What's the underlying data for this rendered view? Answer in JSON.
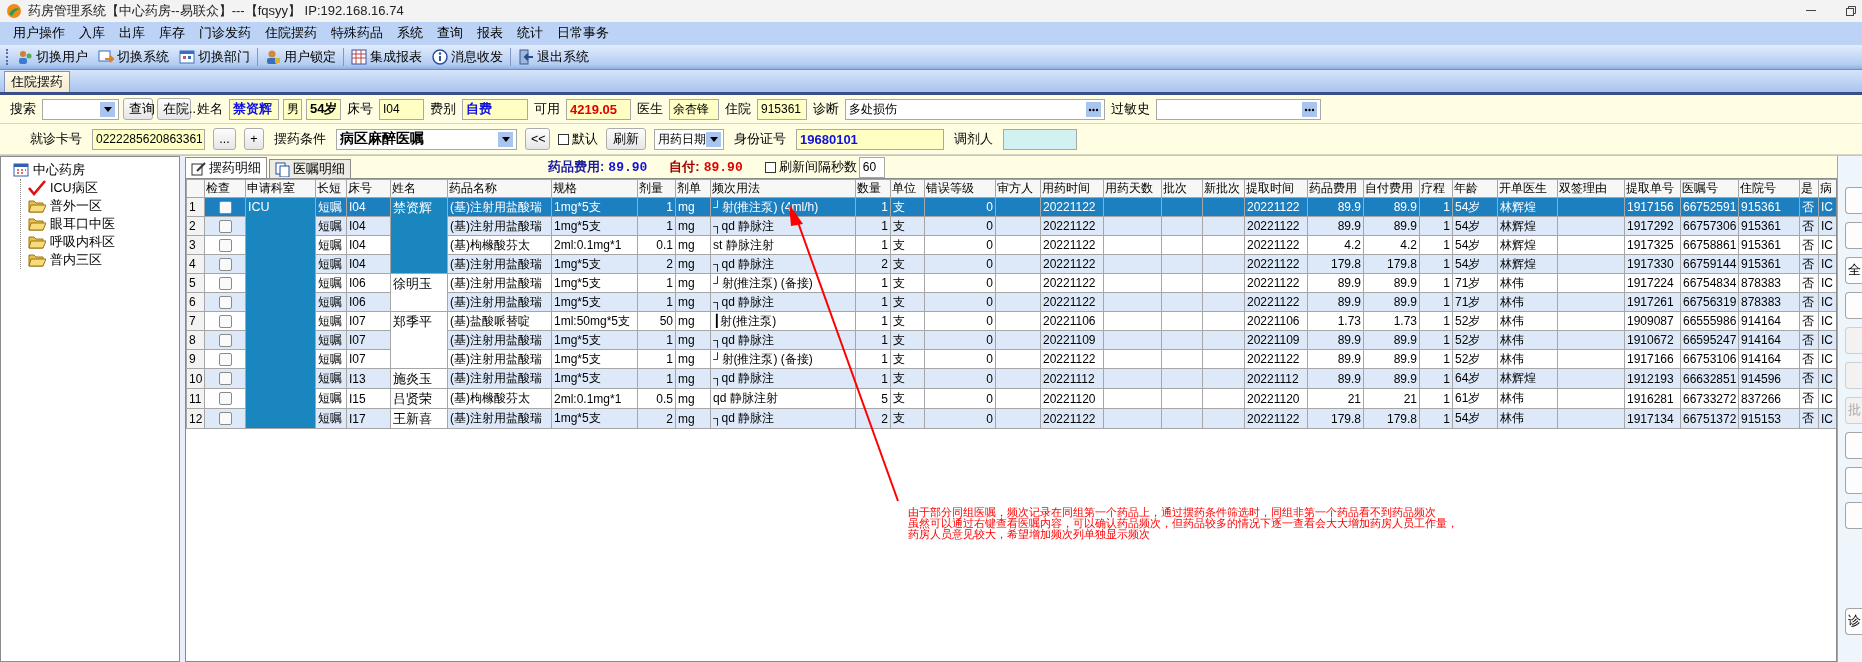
{
  "window": {
    "title": "药房管理系统【中心药房--易联众】---【fqsyy】 IP:192.168.16.74"
  },
  "menu": [
    "用户操作",
    "入库",
    "出库",
    "库存",
    "门诊发药",
    "住院摆药",
    "特殊药品",
    "系统",
    "查询",
    "报表",
    "统计",
    "日常事务"
  ],
  "toolbar": [
    [
      "切换用户",
      "切换系统",
      "切换部门"
    ],
    [
      "用户锁定"
    ],
    [
      "集成报表",
      "消息收发"
    ],
    [
      "退出系统"
    ]
  ],
  "tabs": [
    {
      "label": "住院摆药",
      "selected": true
    }
  ],
  "patient_bar": [
    {
      "kind": "label",
      "text": "搜索"
    },
    {
      "kind": "combo"
    },
    {
      "kind": "button",
      "text": "查询"
    },
    {
      "kind": "button",
      "text": "在院.."
    },
    {
      "kind": "label",
      "text": "姓名"
    },
    {
      "kind": "highlight",
      "text": "禁资辉"
    },
    {
      "kind": "value",
      "text": "男"
    },
    {
      "kind": "strong",
      "text": "54岁"
    },
    {
      "kind": "label",
      "text": "床号"
    },
    {
      "kind": "value",
      "text": "I04"
    },
    {
      "kind": "label",
      "text": "费别"
    },
    {
      "kind": "highlight",
      "text": "自费"
    },
    {
      "kind": "label",
      "text": "可用"
    },
    {
      "kind": "alert",
      "text": "4219.05"
    },
    {
      "kind": "label",
      "text": "医生"
    },
    {
      "kind": "value",
      "text": "余杏锋"
    },
    {
      "kind": "label",
      "text": "住院"
    },
    {
      "kind": "value",
      "text": "915361"
    },
    {
      "kind": "label",
      "text": "诊断"
    },
    {
      "kind": "lookup",
      "text": "多处损伤"
    },
    {
      "kind": "label",
      "text": "过敏史"
    },
    {
      "kind": "lookup"
    }
  ],
  "filter_bar": [
    {
      "kind": "label",
      "text": "就诊卡号"
    },
    {
      "kind": "value",
      "text": "0222285620863361"
    },
    {
      "kind": "button",
      "text": "..."
    },
    {
      "kind": "button",
      "text": "+"
    },
    {
      "kind": "label",
      "text": "摆药条件"
    },
    {
      "kind": "condition",
      "text": "病区麻醉医嘱"
    },
    {
      "kind": "button",
      "text": "<<"
    },
    {
      "kind": "checkbox",
      "text": "默认",
      "checked": false
    },
    {
      "kind": "button",
      "text": "刷新"
    },
    {
      "kind": "combo",
      "text": "用药日期"
    },
    {
      "kind": "label",
      "text": "身份证号"
    },
    {
      "kind": "highlight",
      "text": "19680101"
    },
    {
      "kind": "label",
      "text": "调剂人"
    },
    {
      "kind": "input"
    }
  ],
  "tree": [
    {
      "label": "中心药房",
      "children": [
        {
          "label": "ICU病区",
          "checked": true
        },
        {
          "label": "普外一区",
          "checked": false
        },
        {
          "label": "眼耳口中医",
          "checked": false
        },
        {
          "label": "呼吸内科区",
          "checked": false
        },
        {
          "label": "普内三区",
          "checked": false
        }
      ]
    }
  ],
  "detail_tabs": [
    {
      "label": "摆药明细",
      "selected": true
    },
    {
      "label": "医嘱明细",
      "selected": false
    }
  ],
  "totals": [
    {
      "kind": "drug",
      "label": "药品费用:",
      "value": "89.90"
    },
    {
      "kind": "self",
      "label": "自付:",
      "value": "89.90"
    }
  ],
  "refresh": {
    "label": "刷新间隔秒数",
    "checked": false,
    "value": "60"
  },
  "table": {
    "columns": [
      {
        "kind": "rownum"
      },
      {
        "kind": "check",
        "label": "检查"
      },
      {
        "kind": "dept",
        "label": "申请科室"
      },
      {
        "kind": "text",
        "label": "长短"
      },
      {
        "kind": "text",
        "label": "床号"
      },
      {
        "kind": "name",
        "label": "姓名"
      },
      {
        "kind": "text",
        "label": "药品名称"
      },
      {
        "kind": "text",
        "label": "规格"
      },
      {
        "kind": "num",
        "label": "剂量"
      },
      {
        "kind": "text",
        "label": "剂单"
      },
      {
        "kind": "text",
        "label": "频次用法"
      },
      {
        "kind": "num",
        "label": "数量"
      },
      {
        "kind": "text",
        "label": "单位"
      },
      {
        "kind": "num",
        "label": "错误等级"
      },
      {
        "kind": "blank",
        "label": "审方人"
      },
      {
        "kind": "text",
        "label": "用药时间"
      },
      {
        "kind": "blank",
        "label": "用药天数"
      },
      {
        "kind": "blank",
        "label": "批次"
      },
      {
        "kind": "blank",
        "label": "新批次"
      },
      {
        "kind": "text",
        "label": "提取时间"
      },
      {
        "kind": "num",
        "label": "药品费用"
      },
      {
        "kind": "num",
        "label": "自付费用"
      },
      {
        "kind": "num",
        "label": "疗程"
      },
      {
        "kind": "text",
        "label": "年龄"
      },
      {
        "kind": "text",
        "label": "开单医生"
      },
      {
        "kind": "blank",
        "label": "双签理由"
      },
      {
        "kind": "text",
        "label": "提取单号"
      },
      {
        "kind": "text",
        "label": "医嘱号"
      },
      {
        "kind": "text",
        "label": "住院号"
      },
      {
        "kind": "text",
        "label": "是"
      },
      {
        "kind": "text",
        "label": "病"
      }
    ],
    "department": "ICU",
    "patients": [
      {
        "name": "禁资辉",
        "orders": [
          {
            "no": "1",
            "checked": false,
            "selected": true,
            "cells": [
              "短嘱",
              "I04",
              "(基)注射用盐酸瑞",
              "1mg*5支",
              "1",
              "mg",
              "┘射(推注泵) (4ml/h)",
              "1",
              "支",
              "0",
              "20221122",
              "20221122",
              "89.9",
              "89.9",
              "1",
              "54岁",
              "林辉煌",
              "1917156",
              "66752591",
              "915361",
              "否",
              "IC"
            ]
          },
          {
            "no": "2",
            "checked": false,
            "selected": false,
            "cells": [
              "短嘱",
              "I04",
              "(基)注射用盐酸瑞",
              "1mg*5支",
              "1",
              "mg",
              "┐qd 静脉注",
              "1",
              "支",
              "0",
              "20221122",
              "20221122",
              "89.9",
              "89.9",
              "1",
              "54岁",
              "林辉煌",
              "1917292",
              "66757306",
              "915361",
              "否",
              "IC"
            ]
          },
          {
            "no": "3",
            "checked": false,
            "selected": false,
            "cells": [
              "短嘱",
              "I04",
              "(基)枸橼酸芬太",
              "2ml:0.1mg*1",
              "0.1",
              "mg",
              "st 静脉注射",
              "1",
              "支",
              "0",
              "20221122",
              "20221122",
              "4.2",
              "4.2",
              "1",
              "54岁",
              "林辉煌",
              "1917325",
              "66758861",
              "915361",
              "否",
              "IC"
            ]
          },
          {
            "no": "4",
            "checked": false,
            "selected": false,
            "cells": [
              "短嘱",
              "I04",
              "(基)注射用盐酸瑞",
              "1mg*5支",
              "2",
              "mg",
              "┐qd 静脉注",
              "2",
              "支",
              "0",
              "20221122",
              "20221122",
              "179.8",
              "179.8",
              "1",
              "54岁",
              "林辉煌",
              "1917330",
              "66759144",
              "915361",
              "否",
              "IC"
            ]
          }
        ]
      },
      {
        "name": "徐明玉",
        "orders": [
          {
            "no": "5",
            "checked": false,
            "selected": false,
            "cells": [
              "短嘱",
              "I06",
              "(基)注射用盐酸瑞",
              "1mg*5支",
              "1",
              "mg",
              "┘射(推注泵) (备接)",
              "1",
              "支",
              "0",
              "20221122",
              "20221122",
              "89.9",
              "89.9",
              "1",
              "71岁",
              "林伟",
              "1917224",
              "66754834",
              "878383",
              "否",
              "IC"
            ]
          },
          {
            "no": "6",
            "checked": false,
            "selected": false,
            "cells": [
              "短嘱",
              "I06",
              "(基)注射用盐酸瑞",
              "1mg*5支",
              "1",
              "mg",
              "┐qd 静脉注",
              "1",
              "支",
              "0",
              "20221122",
              "20221122",
              "89.9",
              "89.9",
              "1",
              "71岁",
              "林伟",
              "1917261",
              "66756319",
              "878383",
              "否",
              "IC"
            ]
          }
        ]
      },
      {
        "name": "郑季平",
        "orders": [
          {
            "no": "7",
            "checked": false,
            "selected": false,
            "cells": [
              "短嘱",
              "I07",
              "(基)盐酸哌替啶",
              "1ml:50mg*5支",
              "50",
              "mg",
              "┃射(推注泵)",
              "1",
              "支",
              "0",
              "20221106",
              "20221106",
              "1.73",
              "1.73",
              "1",
              "52岁",
              "林伟",
              "1909087",
              "66555986",
              "914164",
              "否",
              "IC"
            ]
          },
          {
            "no": "8",
            "checked": false,
            "selected": false,
            "cells": [
              "短嘱",
              "I07",
              "(基)注射用盐酸瑞",
              "1mg*5支",
              "1",
              "mg",
              "┐qd 静脉注",
              "1",
              "支",
              "0",
              "20221109",
              "20221109",
              "89.9",
              "89.9",
              "1",
              "52岁",
              "林伟",
              "1910672",
              "66595247",
              "914164",
              "否",
              "IC"
            ]
          },
          {
            "no": "9",
            "checked": false,
            "selected": false,
            "cells": [
              "短嘱",
              "I07",
              "(基)注射用盐酸瑞",
              "1mg*5支",
              "1",
              "mg",
              "┘射(推注泵) (备接)",
              "1",
              "支",
              "0",
              "20221122",
              "20221122",
              "89.9",
              "89.9",
              "1",
              "52岁",
              "林伟",
              "1917166",
              "66753106",
              "914164",
              "否",
              "IC"
            ]
          }
        ]
      },
      {
        "name": "施炎玉",
        "orders": [
          {
            "no": "10",
            "checked": false,
            "selected": false,
            "cells": [
              "短嘱",
              "I13",
              "(基)注射用盐酸瑞",
              "1mg*5支",
              "1",
              "mg",
              "┐qd 静脉注",
              "1",
              "支",
              "0",
              "20221112",
              "20221112",
              "89.9",
              "89.9",
              "1",
              "64岁",
              "林辉煌",
              "1912193",
              "66632851",
              "914596",
              "否",
              "IC"
            ]
          }
        ]
      },
      {
        "name": "吕贤荣",
        "orders": [
          {
            "no": "11",
            "checked": false,
            "selected": false,
            "cells": [
              "短嘱",
              "I15",
              "(基)枸橼酸芬太",
              "2ml:0.1mg*1",
              "0.5",
              "mg",
              "qd 静脉注射",
              "5",
              "支",
              "0",
              "20221120",
              "20221120",
              "21",
              "21",
              "1",
              "61岁",
              "林伟",
              "1916281",
              "66733272",
              "837266",
              "否",
              "IC"
            ]
          }
        ]
      },
      {
        "name": "王新喜",
        "orders": [
          {
            "no": "12",
            "checked": false,
            "selected": false,
            "cells": [
              "短嘱",
              "I17",
              "(基)注射用盐酸瑞",
              "1mg*5支",
              "2",
              "mg",
              "┐qd 静脉注",
              "2",
              "支",
              "0",
              "20221122",
              "20221122",
              "179.8",
              "179.8",
              "1",
              "54岁",
              "林伟",
              "1917134",
              "66751372",
              "915153",
              "否",
              "IC"
            ]
          }
        ]
      }
    ]
  },
  "side_buttons": [
    {
      "disabled": false
    },
    {
      "disabled": false
    },
    {
      "label": "全",
      "disabled": false
    },
    {
      "disabled": false
    },
    {
      "disabled": true
    },
    {
      "disabled": true
    },
    {
      "label": "批",
      "disabled": true
    },
    {
      "disabled": false
    },
    {
      "disabled": false
    },
    {
      "disabled": false
    },
    {
      "label": "诊",
      "disabled": false
    }
  ],
  "note": {
    "lines": [
      "由于部分同组医嘱，频次记录在同组第一个药品上，通过摆药条件筛选时，同组非第一个药品看不到药品频次",
      "虽然可以通过右键查看医嘱内容，可以确认药品频次，但药品较多的情况下逐一查看会大大增加药房人员工作量，",
      "药房人员意见较大，希望增加频次列单独显示频次"
    ]
  }
}
